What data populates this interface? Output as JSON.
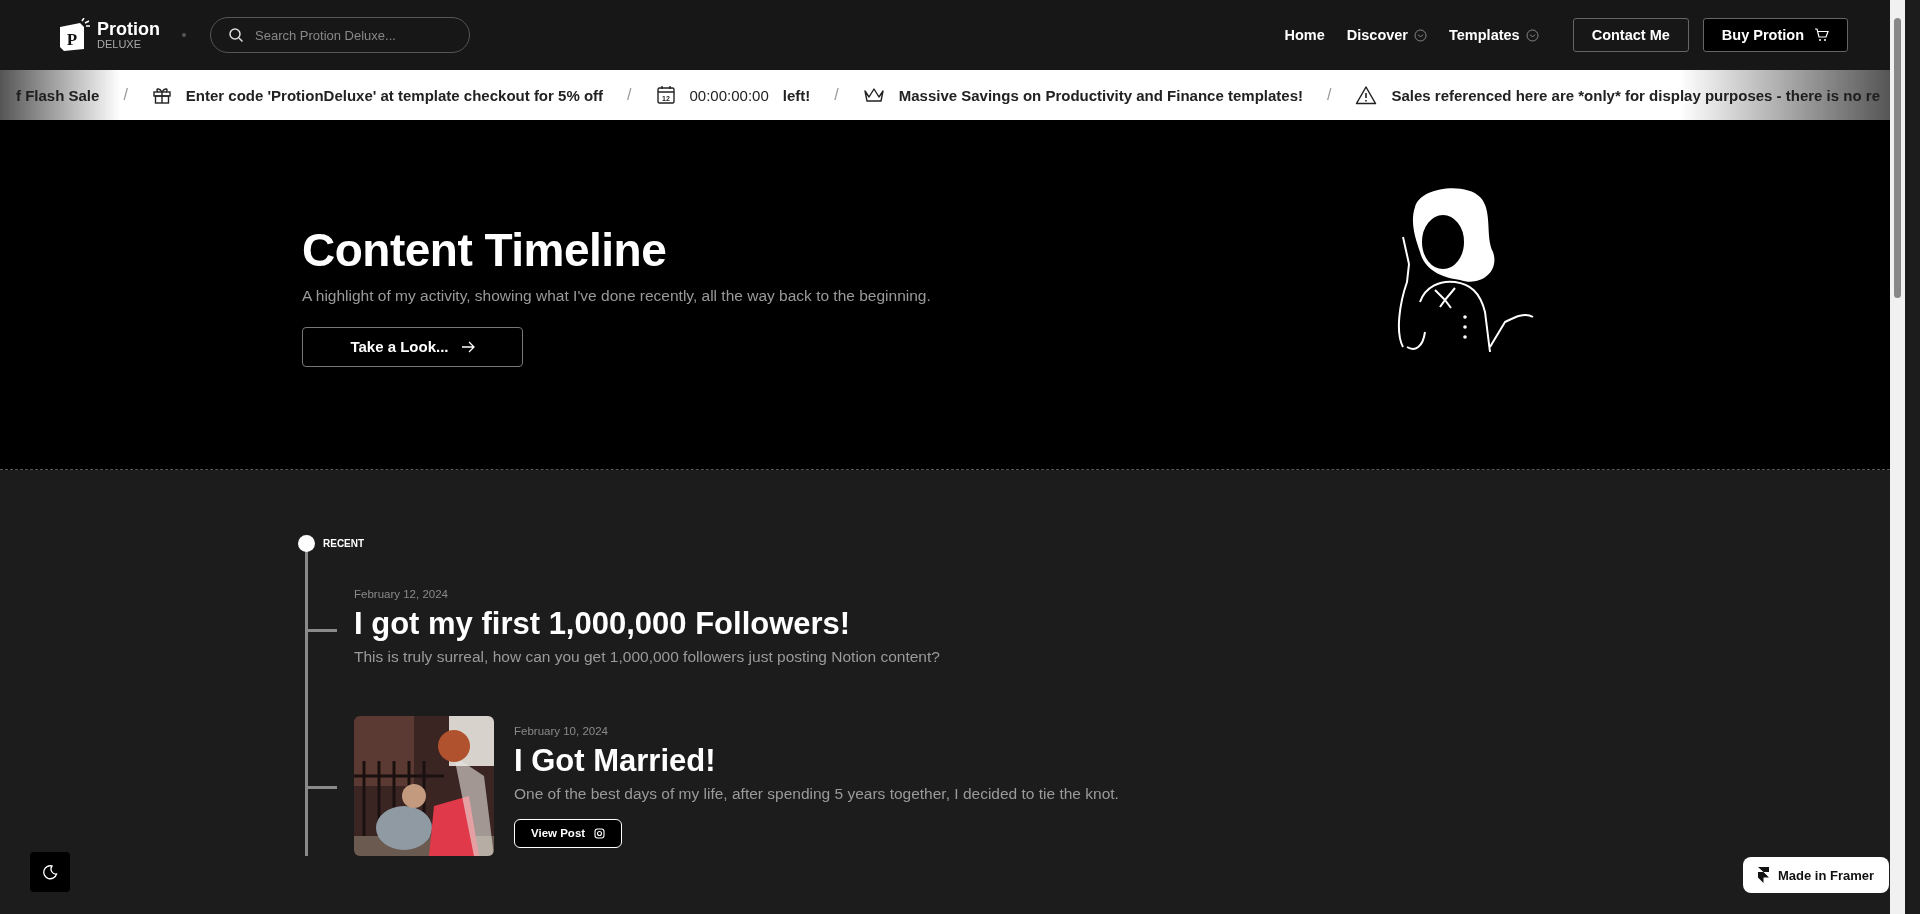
{
  "nav": {
    "logo": {
      "name": "Protion",
      "sub": "DELUXE",
      "mark": "P"
    },
    "search": {
      "placeholder": "Search Protion Deluxe..."
    },
    "links": [
      {
        "label": "Home",
        "dropdown": false
      },
      {
        "label": "Discover",
        "dropdown": true
      },
      {
        "label": "Templates",
        "dropdown": true
      }
    ],
    "buttons": [
      {
        "label": "Contact Me",
        "kind": "plain"
      },
      {
        "label": "Buy Protion",
        "kind": "cart"
      }
    ]
  },
  "ticker": [
    {
      "kind": "plain",
      "text": "f Flash Sale"
    },
    {
      "kind": "separator",
      "text": "/"
    },
    {
      "kind": "gift",
      "text": "Enter code 'ProtionDeluxe' at template checkout for 5% off"
    },
    {
      "kind": "separator",
      "text": "/"
    },
    {
      "kind": "timer",
      "icon_text": "12",
      "text": "00:00:00:00",
      "suffix": "left!"
    },
    {
      "kind": "separator",
      "text": "/"
    },
    {
      "kind": "crown",
      "text": "Massive Savings on Productivity and Finance templates!"
    },
    {
      "kind": "separator",
      "text": "/"
    },
    {
      "kind": "notice",
      "text": "Sales referenced here are *only* for display purposes - there is no re"
    }
  ],
  "hero": {
    "title": "Content Timeline",
    "subtitle": "A highlight of my activity, showing what I've done recently, all the way back to the beginning.",
    "button": "Take a Look..."
  },
  "timeline": {
    "start_label": "RECENT",
    "entries": [
      {
        "date": "February 12, 2024",
        "title": "I got my first 1,000,000 Followers!",
        "description": "This is truly surreal, how can you get 1,000,000 followers just posting Notion content?",
        "kind": "text"
      },
      {
        "date": "February 10, 2024",
        "title": "I Got Married!",
        "description": "One of the best days of my life, after spending 5 years together, I decided to tie the knot.",
        "button": "View Post"
      }
    ]
  },
  "badge": {
    "label": "Made in Framer"
  }
}
